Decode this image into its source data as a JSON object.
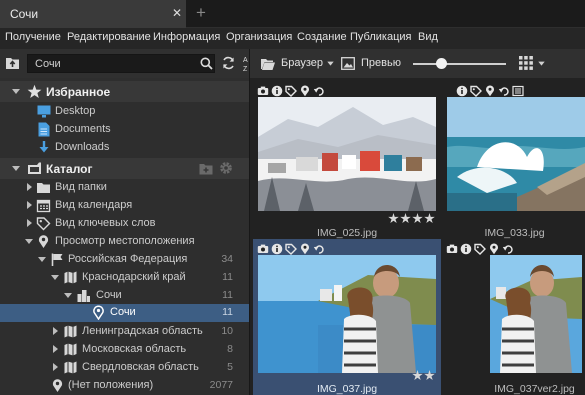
{
  "window": {
    "tab_title": "Сочи",
    "close_glyph": "✕",
    "add_glyph": "+"
  },
  "menu": [
    "Получение",
    "Редактирование",
    "Информация",
    "Организация",
    "Создание",
    "Публикация",
    "Вид"
  ],
  "left_toolbar": {
    "search_value": "Сочи",
    "icons": [
      "folder-up-icon",
      "search-icon",
      "refresh-icon",
      "sort-az-icon"
    ]
  },
  "right_toolbar": {
    "browser_label": "Браузер",
    "preview_label": "Превью",
    "zoom_fraction": 0.3,
    "icons": [
      "browser-folder-icon",
      "dropdown-arrow-icon",
      "preview-icon",
      "zoom-slider",
      "grid-view-icon"
    ]
  },
  "favorites": {
    "title": "Избранное",
    "items": [
      {
        "label": "Desktop",
        "icon": "desktop-icon"
      },
      {
        "label": "Documents",
        "icon": "documents-icon"
      },
      {
        "label": "Downloads",
        "icon": "downloads-icon"
      }
    ]
  },
  "catalog": {
    "title": "Каталог",
    "items": [
      {
        "label": "Вид папки",
        "icon": "folder-icon",
        "count": ""
      },
      {
        "label": "Вид календаря",
        "icon": "calendar-icon",
        "count": ""
      },
      {
        "label": "Вид ключевых слов",
        "icon": "tag-icon",
        "count": ""
      },
      {
        "label": "Просмотр местоположения",
        "icon": "location-pin-icon",
        "count": ""
      },
      {
        "label": "Российская Федерация",
        "icon": "flag-icon",
        "count": "34"
      },
      {
        "label": "Краснодарский край",
        "icon": "map-icon",
        "count": "11"
      },
      {
        "label": "Сочи",
        "icon": "city-icon",
        "count": "11"
      },
      {
        "label": "Сочи",
        "icon": "location-pin-icon",
        "count": "11"
      },
      {
        "label": "Ленинградская область",
        "icon": "map-icon",
        "count": "10"
      },
      {
        "label": "Московская область",
        "icon": "map-icon",
        "count": "8"
      },
      {
        "label": "Свердловская область",
        "icon": "map-icon",
        "count": "5"
      },
      {
        "label": "(Нет положения)",
        "icon": "location-pin-icon",
        "count": "2077"
      }
    ]
  },
  "thumbnails": [
    {
      "filename": "IMG_025.jpg",
      "rating": 4,
      "selected": false,
      "icons": [
        "camera-icon",
        "info-icon",
        "tag-icon",
        "location-pin-icon",
        "undo-icon"
      ]
    },
    {
      "filename": "IMG_033.jpg",
      "rating": 0,
      "selected": false,
      "icons": [
        "info-icon",
        "tag-icon",
        "location-pin-icon",
        "undo-icon",
        "adjust-icon"
      ]
    },
    {
      "filename": "IMG_037.jpg",
      "rating": 2,
      "selected": true,
      "icons": [
        "camera-icon",
        "info-icon",
        "tag-icon",
        "location-pin-icon",
        "undo-icon"
      ]
    },
    {
      "filename": "IMG_037ver2.jpg",
      "rating": 0,
      "selected": false,
      "icons": [
        "camera-icon",
        "info-icon",
        "tag-icon",
        "location-pin-icon",
        "undo-icon"
      ]
    }
  ],
  "colors": {
    "selection": "#3d5e84",
    "panel": "#2e2e2e",
    "background": "#222222",
    "accent_blue": "#4a9fe0"
  }
}
